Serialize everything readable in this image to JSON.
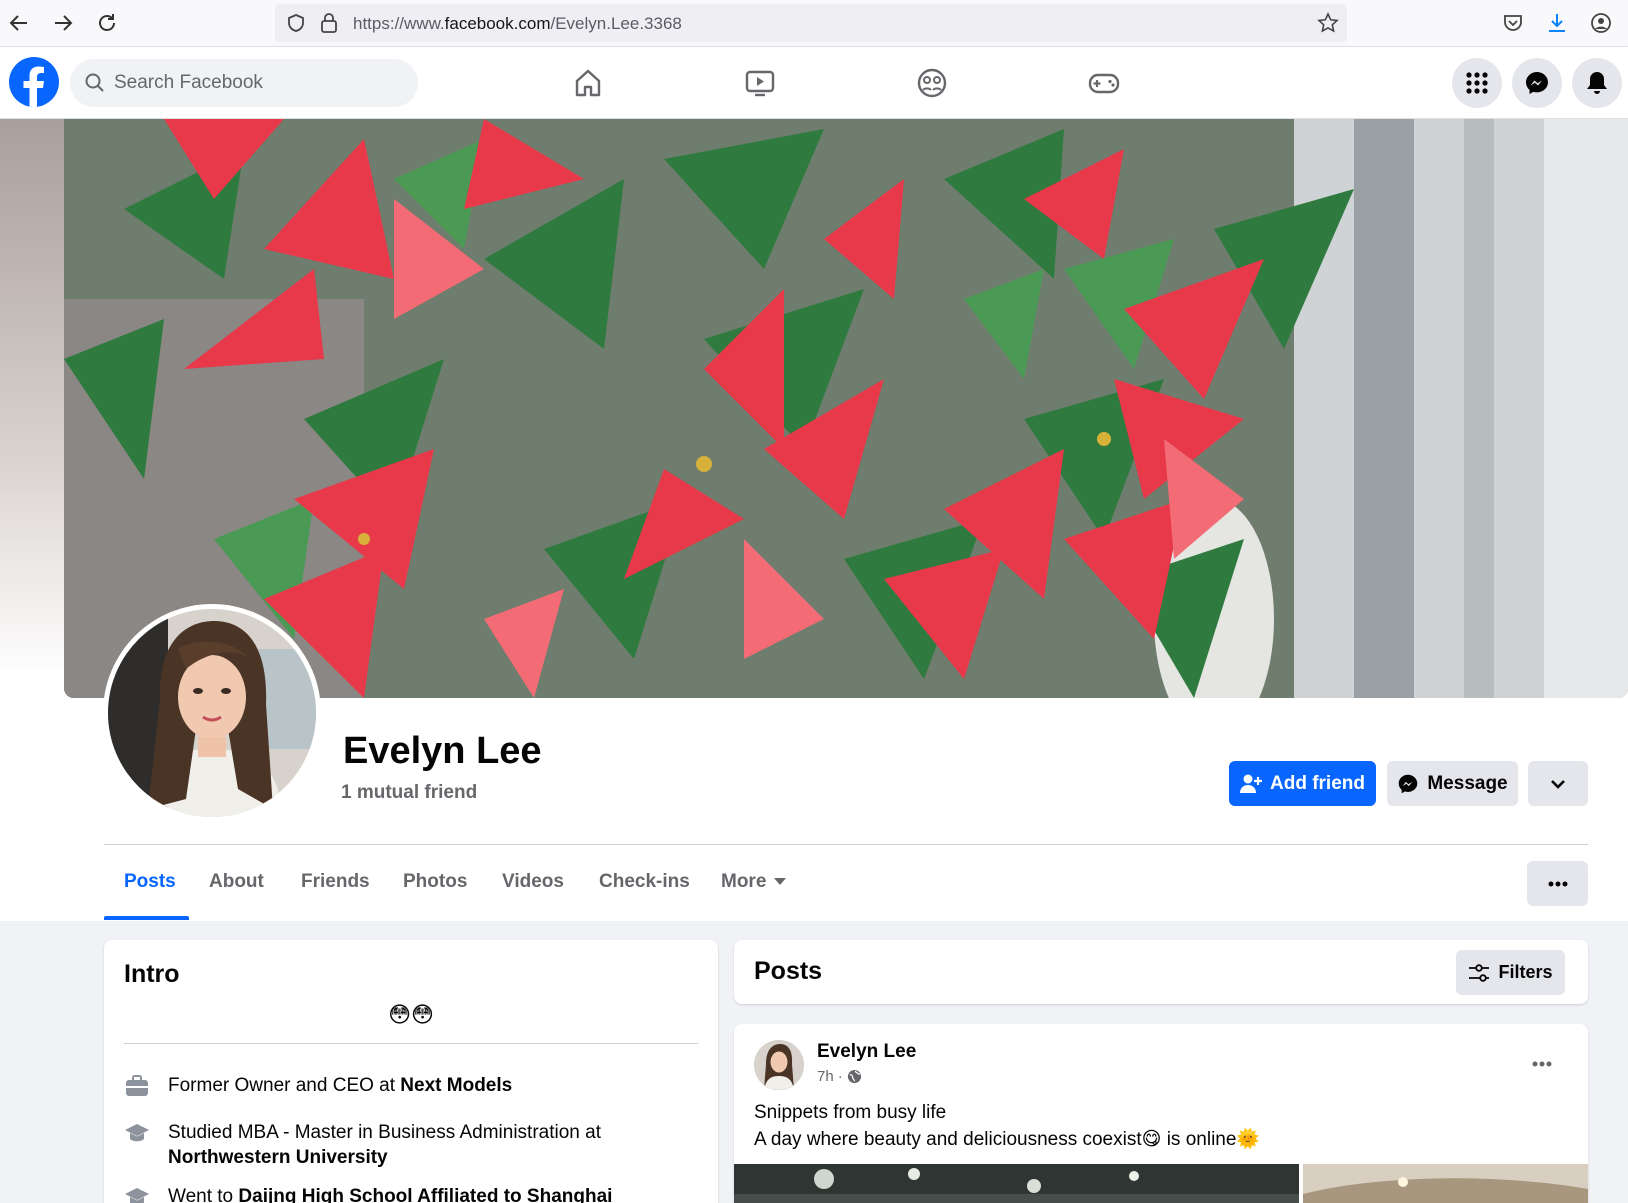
{
  "browser": {
    "url_prefix": "https://www.",
    "url_domain": "facebook.com",
    "url_path": "/Evelyn.Lee.3368"
  },
  "header": {
    "search_placeholder": "Search Facebook"
  },
  "profile": {
    "name": "Evelyn Lee",
    "mutual": "1 mutual friend",
    "add_friend_label": "Add friend",
    "message_label": "Message"
  },
  "tabs": [
    {
      "label": "Posts"
    },
    {
      "label": "About"
    },
    {
      "label": "Friends"
    },
    {
      "label": "Photos"
    },
    {
      "label": "Videos"
    },
    {
      "label": "Check-ins"
    },
    {
      "label": "More"
    }
  ],
  "intro": {
    "title": "Intro",
    "bio_emoji": "😳😳",
    "work_prefix": "Former Owner and CEO at ",
    "work_place": "Next Models",
    "study_prefix": "Studied MBA - Master in Business Administration at ",
    "study_place": "Northwestern University",
    "school_prefix": "Went to ",
    "school_place": "Daijng High School Affiliated to Shanghai"
  },
  "posts_header": {
    "title": "Posts",
    "filters_label": "Filters"
  },
  "post": {
    "author": "Evelyn Lee",
    "time": "7h",
    "line1": "Snippets from busy life",
    "line2": "A day where beauty and deliciousness coexist😋 is online🌞"
  },
  "colors": {
    "brand": "#0866ff",
    "secondary_button": "#e4e6eb",
    "page_bg": "#f0f2f5"
  }
}
